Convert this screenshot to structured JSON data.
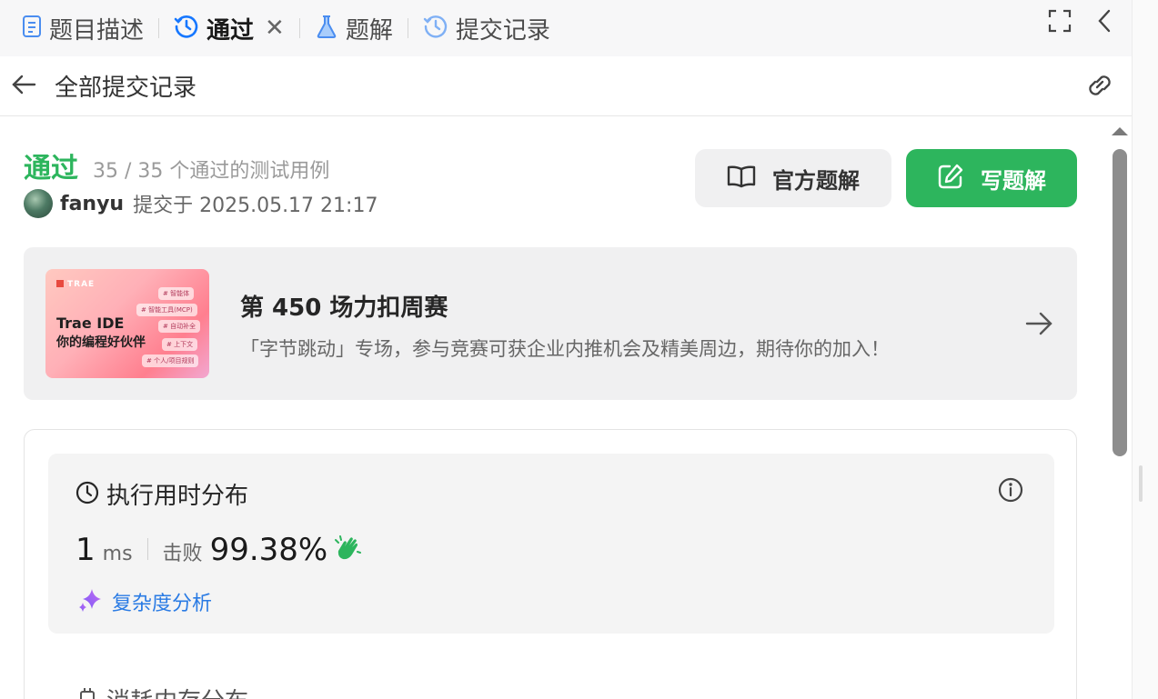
{
  "tabs": [
    {
      "label": "题目描述",
      "icon": "document-icon"
    },
    {
      "label": "通过",
      "icon": "history-icon",
      "active": true,
      "closable": true
    },
    {
      "label": "题解",
      "icon": "flask-icon"
    },
    {
      "label": "提交记录",
      "icon": "history-icon"
    }
  ],
  "subheader": {
    "back_label": "全部提交记录"
  },
  "submission": {
    "status": "通过",
    "cases": "35 / 35 个通过的测试用例",
    "author": "fanyu",
    "submitted_at": "提交于 2025.05.17 21:17"
  },
  "buttons": {
    "official_solution": "官方题解",
    "write_solution": "写题解"
  },
  "promo": {
    "title": "第 450 场力扣周赛",
    "subtitle": "「字节跳动」专场，参与竞赛可获企业内推机会及精美周边，期待你的加入！",
    "image": {
      "brand": "TRAE",
      "line1": "Trae IDE",
      "line2": "你的编程好伙伴",
      "chips": [
        "# 智能体",
        "# 智能工具(MCP)",
        "# 自动补全",
        "# 上下文",
        "# 个人/项目规则"
      ]
    }
  },
  "runtime": {
    "heading": "执行用时分布",
    "value": "1",
    "unit": "ms",
    "beat_label": "击败",
    "beat_percent": "99.38%",
    "complexity_label": "复杂度分析"
  },
  "memory": {
    "heading": "消耗内存分布"
  },
  "colors": {
    "accent_green": "#2db55d",
    "link_blue": "#2a7be4",
    "tab_blue": "#1677ff"
  }
}
